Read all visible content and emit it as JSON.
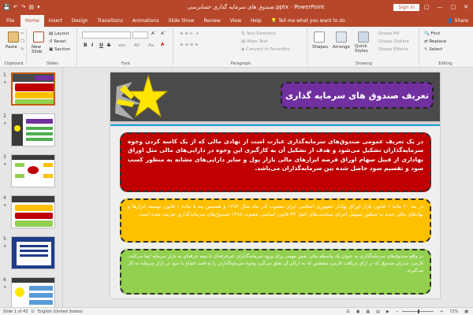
{
  "titlebar": {
    "title": "صندوق های سرمایه گذاری حسابرسی.pptx  -  PowerPoint",
    "signin": "Sign in",
    "qat": [
      "save-icon",
      "undo-icon",
      "redo-icon",
      "present-icon"
    ],
    "controls": [
      "minimize-icon",
      "maximize-icon",
      "close-icon"
    ]
  },
  "tabs": {
    "items": [
      "File",
      "Home",
      "Insert",
      "Design",
      "Transitions",
      "Animations",
      "Slide Show",
      "Review",
      "View",
      "Help"
    ],
    "active": "Home",
    "tellme": "Tell me what you want to do",
    "share": "Share"
  },
  "ribbon": {
    "clipboard": {
      "label": "Clipboard",
      "paste": "Paste"
    },
    "slides": {
      "label": "Slides",
      "new_slide": "New\nSlide",
      "layout": "Layout",
      "reset": "Reset",
      "section": "Section"
    },
    "font": {
      "label": "Font",
      "bold": "B",
      "italic": "I",
      "underline": "U",
      "strike": "S"
    },
    "paragraph": {
      "label": "Paragraph",
      "text_direction": "Text Direction",
      "align_text": "Align Text",
      "smartart": "Convert to SmartArt"
    },
    "drawing": {
      "label": "Drawing",
      "shapes": "Shapes",
      "arrange": "Arrange",
      "quick_styles": "Quick\nStyles",
      "shape_fill": "Shape Fill",
      "shape_outline": "Shape Outline",
      "shape_effects": "Shape Effects"
    },
    "editing": {
      "label": "Editing",
      "find": "Find",
      "replace": "Replace",
      "select": "Select"
    }
  },
  "slides_panel": {
    "items": [
      {
        "num": "1",
        "active": true
      },
      {
        "num": "2",
        "active": false
      },
      {
        "num": "3",
        "active": false
      },
      {
        "num": "4",
        "active": false
      },
      {
        "num": "5",
        "active": false
      },
      {
        "num": "6",
        "active": false
      }
    ]
  },
  "slide": {
    "title": "تعریف صندوق های سرمایه گذاری",
    "box1": "در یک تعریف عمومی صندوق‌های سرمایه‌گذاری عبارت است از نهادی مالی که از یک کاسه کردن وجوه سرمایه‌گذاران تشکیل می‌شود و هدف از تشکیل آن به کارگیری این وجوه در دارایی‌های مالی مثل اوراق بهاداری از قبیل سهام اوراق قرضه ابزارهای مالی بازار پول و سایر دارایی‌های مشابه به منظور کسب سود و تقسیم سود حاصل شده بین سرمایه‌گذاران می‌باشد.",
    "box2": "در بند ۲۰ ماده ۱ قانون بازار اوراق بهادار جمهوری اسلامی ایران مصوب آذر ماه سال ۱۳۸۴ و همچنین بند ۵ ماده ۱ قانون توسعه ابزارها و نهادهای مالی جدید به منظور تسهیل اجرای سیاست‌های اصل ۴۴ قانون اساسی مصوب ۱۳۸۸ صندوق‌های سرمایه‌گذاری تعریف شده است.",
    "box3": "در واقع صندوق‌های سرمایه‌گذاری به عنوان یک واسطه مالی نقش مهمی برای ورود سرمایه‌گذاران غیرحرفه‌ای با نیمه حرفه‌ای به بازار سرمایه ایفا می‌کنند. کارمزد مدیران صندوق که در ازای دریافت کارمزد مشخص که به ارکان آن تعلق می‌گیرد وجوه سرمایه‌گذاران را به قصد انتفاع یا سود در بازار سرمایه به کار می‌گیرند."
  },
  "statusbar": {
    "slide_info": "Slide 1 of 43",
    "language": "English (United States)",
    "zoom": "72%",
    "zoom_fraction": 0.72
  },
  "colors": {
    "accent": "#b7472a",
    "title_box": "#7030a0",
    "box1": "#c00000",
    "box2": "#ffc000",
    "box3": "#92d050",
    "star": "#ffe600"
  }
}
